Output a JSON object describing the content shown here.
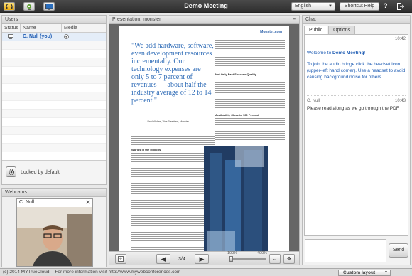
{
  "app": {
    "title": "Demo Meeting"
  },
  "header": {
    "language": "English",
    "shortcut_help": "Shortcut Help",
    "help_mark": "?"
  },
  "users": {
    "title": "Users",
    "columns": [
      "Status",
      "Name",
      "Media"
    ],
    "rows": [
      {
        "name": "C. Null (you)"
      }
    ],
    "lock_text": "Locked by default"
  },
  "webcams": {
    "title": "Webcams",
    "cam_name": "C. Null"
  },
  "presentation": {
    "title": "Presentation: monster",
    "page_indicator": "3/4",
    "zoom_min": "100%",
    "zoom_max": "400%",
    "doc_header": "Monster.com",
    "quote": "\"We add hardware, software, even development resources incrementally. Our technology expenses are only 5 to 7 percent of revenues — about half the industry average of 12 to 14 percent.\"",
    "quote_author": "— Paul Wickes, Vice President, Monster",
    "section1": "Worlds in the Millions",
    "section2": "Not Only Fast Success Quality",
    "section3": "Availability Close to 100 Percent"
  },
  "chat": {
    "title": "Chat",
    "tabs": [
      "Public",
      "Options"
    ],
    "messages": [
      {
        "time": "10:42",
        "welcome_prefix": "Welcome to ",
        "welcome_bold": "Demo Meeting",
        "welcome_suffix": "!",
        "body": "To join the audio bridge click the headset icon (upper-left hand corner). Use a headset to avoid causing background noise for others."
      },
      {
        "sender": "C. Null",
        "time": "10:43",
        "text": "Please read along as we go through the PDF"
      }
    ],
    "dot": ".",
    "send_label": "Send"
  },
  "footer": {
    "copyright": "(c) 2014 MYTrueCloud -- For more information visit http://www.mywebconferences.com",
    "layout": "Custom layout"
  },
  "colors": {
    "accent": "#1e5cb3",
    "topbar": "#3a3a3a",
    "highlight": "#f0b21e"
  }
}
